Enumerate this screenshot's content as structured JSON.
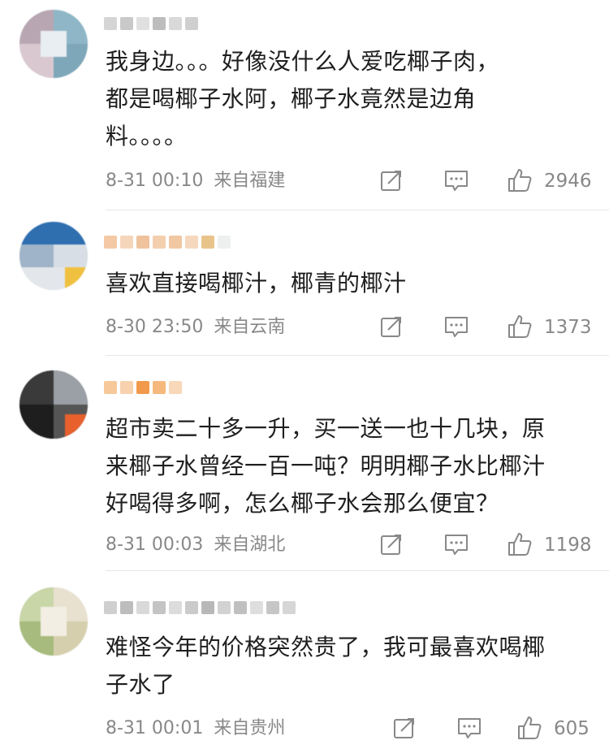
{
  "comments": [
    {
      "text": "我身边。。。好像没什么人爱吃椰子肉，\n都是喝椰子水阿，椰子水竟然是边角\n料。。。。",
      "time": "8-31 00:10",
      "location": "来自福建",
      "likes": "2946"
    },
    {
      "text": "喜欢直接喝椰汁，椰青的椰汁",
      "time": "8-30 23:50",
      "location": "来自云南",
      "likes": "1373"
    },
    {
      "text": "超市卖二十多一升，买一送一也十几块，原\n来椰子水曾经一百一吨？明明椰子水比椰汁\n好喝得多啊，怎么椰子水会那么便宜？",
      "time": "8-31 00:03",
      "location": "来自湖北",
      "likes": "1198"
    },
    {
      "text": "难怪今年的价格突然贵了，我可最喜欢喝椰\n子水了",
      "time": "8-31 00:01",
      "location": "来自贵州",
      "likes": "605"
    }
  ],
  "icons": {
    "repost": "repost-icon",
    "comment": "comment-icon",
    "like": "like-icon"
  },
  "colors": {
    "text": "#1f1f1f",
    "meta": "#888888",
    "divider": "#e6e6e6"
  }
}
